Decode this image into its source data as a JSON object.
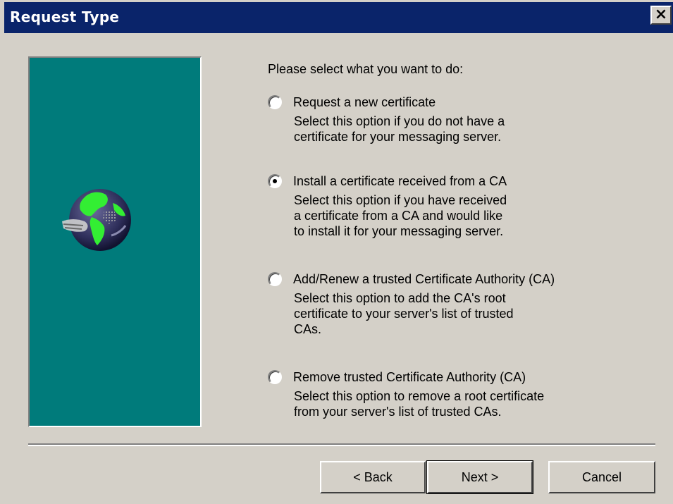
{
  "window": {
    "title": "Request Type",
    "close_glyph": "✕"
  },
  "side_panel": {
    "background": "#007b7b",
    "image": "globe-icon"
  },
  "prompt": "Please select what you want to do:",
  "options": [
    {
      "label": "Request a new certificate",
      "checked": false,
      "desc": [
        "Select this option if you do not have a",
        "certificate for your messaging server."
      ]
    },
    {
      "label": "Install a certificate received from a CA",
      "checked": true,
      "desc": [
        "Select this option if you have received",
        "a certificate from a CA and would like",
        "to install it for your messaging server."
      ]
    },
    {
      "label": "Add/Renew a trusted Certificate Authority (CA)",
      "checked": false,
      "desc": [
        "Select this option to add the CA's root",
        "certificate to your server's list of trusted",
        "CAs."
      ]
    },
    {
      "label": "Remove trusted Certificate Authority (CA)",
      "checked": false,
      "desc": [
        "Select this option to remove a root certificate",
        "from your server's list of trusted CAs."
      ]
    }
  ],
  "buttons": {
    "back": "< Back",
    "next": "Next >",
    "cancel": "Cancel"
  },
  "colors": {
    "titlebar": "#0a246a",
    "face": "#d4d0c8",
    "panel": "#007b7b"
  }
}
